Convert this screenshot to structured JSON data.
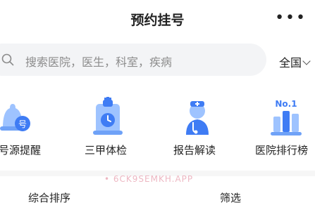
{
  "header": {
    "title": "预约挂号",
    "more_label": "•••"
  },
  "search": {
    "placeholder": "搜索医院，医生，科室，疾病",
    "region": "全国"
  },
  "shortcuts": [
    {
      "label": "号源提醒",
      "icon": "bell-number-icon"
    },
    {
      "label": "三甲体检",
      "icon": "clipboard-clock-icon"
    },
    {
      "label": "报告解读",
      "icon": "doctor-icon"
    },
    {
      "label": "医院排行榜",
      "icon": "no1-ranking-icon"
    }
  ],
  "rank_icon_text": "No.1",
  "bell_icon_text": "号",
  "watermark": "• 6CK9SEMKH.APP",
  "bottom_tabs": {
    "left": "综合排序",
    "right": "筛选"
  },
  "colors": {
    "icon_blue": "#3f7cf4",
    "icon_light_blue": "#9ec3ff",
    "search_bg": "#f3f4f6"
  }
}
